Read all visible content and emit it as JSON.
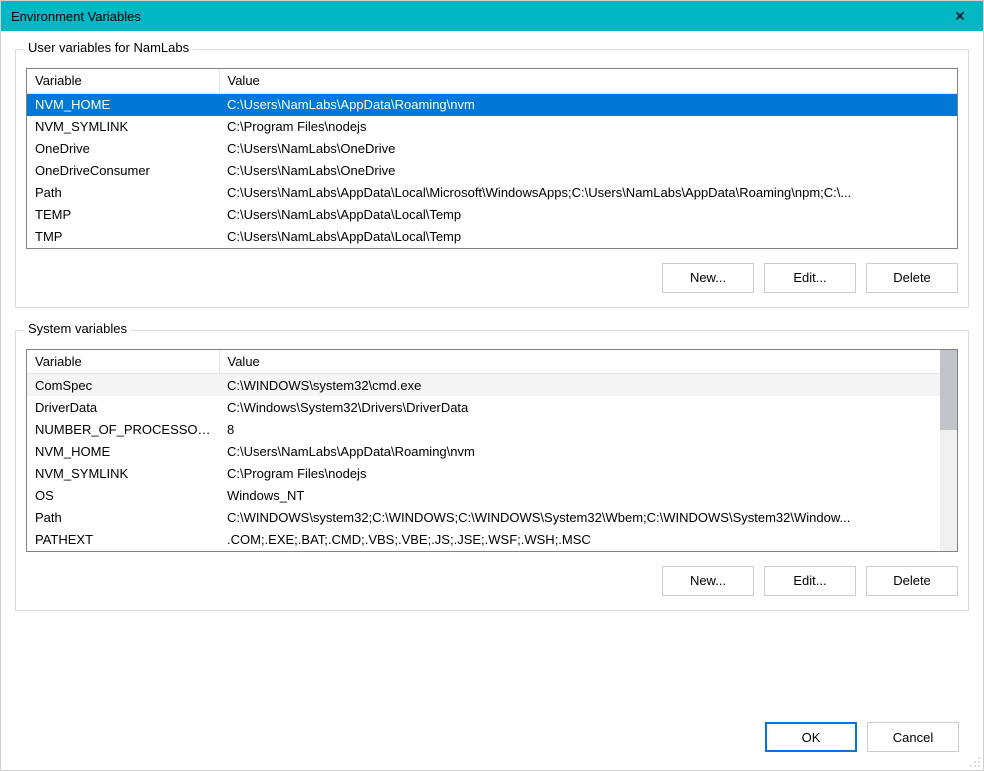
{
  "window": {
    "title": "Environment Variables",
    "close_label": "✕"
  },
  "userSection": {
    "label": "User variables for NamLabs",
    "col_var": "Variable",
    "col_val": "Value",
    "rows": [
      {
        "variable": "NVM_HOME",
        "value": "C:\\Users\\NamLabs\\AppData\\Roaming\\nvm"
      },
      {
        "variable": "NVM_SYMLINK",
        "value": "C:\\Program Files\\nodejs"
      },
      {
        "variable": "OneDrive",
        "value": "C:\\Users\\NamLabs\\OneDrive"
      },
      {
        "variable": "OneDriveConsumer",
        "value": "C:\\Users\\NamLabs\\OneDrive"
      },
      {
        "variable": "Path",
        "value": "C:\\Users\\NamLabs\\AppData\\Local\\Microsoft\\WindowsApps;C:\\Users\\NamLabs\\AppData\\Roaming\\npm;C:\\..."
      },
      {
        "variable": "TEMP",
        "value": "C:\\Users\\NamLabs\\AppData\\Local\\Temp"
      },
      {
        "variable": "TMP",
        "value": "C:\\Users\\NamLabs\\AppData\\Local\\Temp"
      }
    ],
    "selected_index": 0,
    "btn_new": "New...",
    "btn_edit": "Edit...",
    "btn_delete": "Delete"
  },
  "systemSection": {
    "label": "System variables",
    "col_var": "Variable",
    "col_val": "Value",
    "rows": [
      {
        "variable": "ComSpec",
        "value": "C:\\WINDOWS\\system32\\cmd.exe"
      },
      {
        "variable": "DriverData",
        "value": "C:\\Windows\\System32\\Drivers\\DriverData"
      },
      {
        "variable": "NUMBER_OF_PROCESSORS",
        "value": "8"
      },
      {
        "variable": "NVM_HOME",
        "value": "C:\\Users\\NamLabs\\AppData\\Roaming\\nvm"
      },
      {
        "variable": "NVM_SYMLINK",
        "value": "C:\\Program Files\\nodejs"
      },
      {
        "variable": "OS",
        "value": "Windows_NT"
      },
      {
        "variable": "Path",
        "value": "C:\\WINDOWS\\system32;C:\\WINDOWS;C:\\WINDOWS\\System32\\Wbem;C:\\WINDOWS\\System32\\Window..."
      }
    ],
    "partial_row": {
      "variable": "PATHEXT",
      "value": ".COM;.EXE;.BAT;.CMD;.VBS;.VBE;.JS;.JSE;.WSF;.WSH;.MSC"
    },
    "btn_new": "New...",
    "btn_edit": "Edit...",
    "btn_delete": "Delete"
  },
  "dialog": {
    "btn_ok": "OK",
    "btn_cancel": "Cancel"
  }
}
